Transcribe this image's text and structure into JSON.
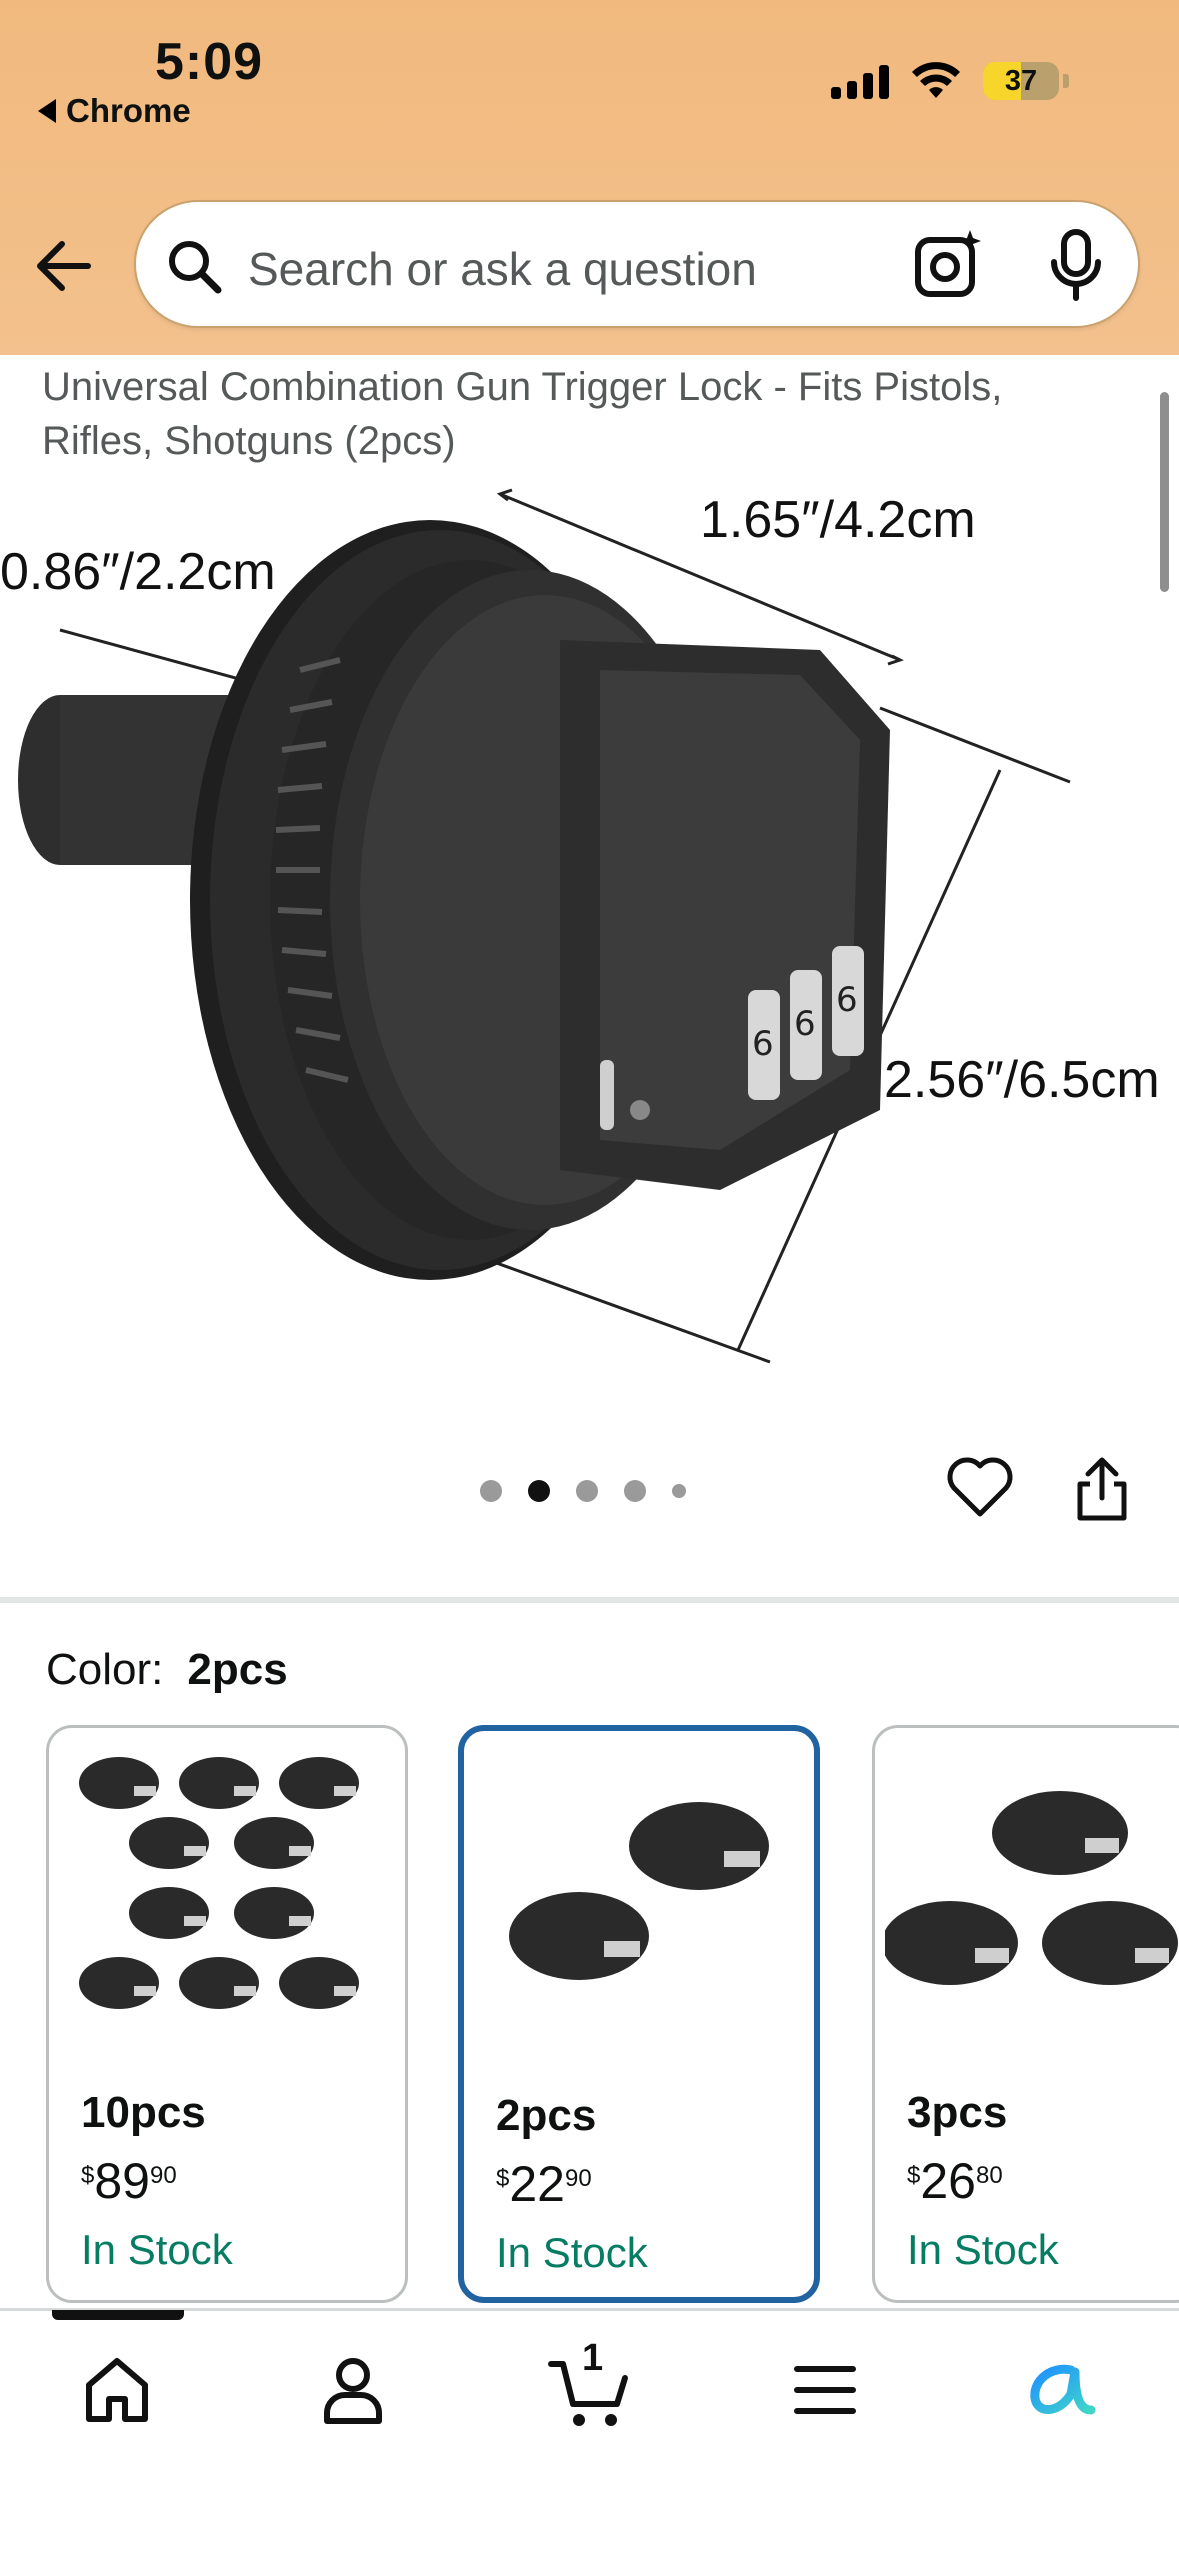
{
  "status_bar": {
    "time": "5:09",
    "back_app": "Chrome",
    "battery": "37"
  },
  "header": {
    "search_placeholder": "Search or ask a question",
    "icons": [
      "back-arrow-icon",
      "search-icon",
      "camera-lens-icon",
      "microphone-icon"
    ],
    "background": "#f3c18d"
  },
  "product": {
    "title": "Universal Combination Gun Trigger Lock - Fits Pistols, Rifles, Shotguns (2pcs)",
    "image_dimensions": {
      "width": "1.65″/4.2cm",
      "shaft": "0.86″/2.2cm",
      "height": "2.56″/6.5cm"
    },
    "image_count": 5,
    "active_image": 2
  },
  "color": {
    "label": "Color:",
    "selected": "2pcs"
  },
  "variants": [
    {
      "name": "10pcs",
      "currency": "$",
      "whole": "89",
      "fraction": "90",
      "stock": "In Stock"
    },
    {
      "name": "2pcs",
      "currency": "$",
      "whole": "22",
      "fraction": "90",
      "stock": "In Stock"
    },
    {
      "name": "3pcs",
      "currency": "$",
      "whole": "26",
      "fraction": "80",
      "stock": "In Stock"
    }
  ],
  "bottom_nav": {
    "items": [
      "home-icon",
      "account-icon",
      "cart-icon",
      "menu-icon",
      "rufus-icon"
    ],
    "cart_count": "1"
  },
  "colors": {
    "accent_selected": "#2162a1",
    "in_stock": "#067d62"
  }
}
